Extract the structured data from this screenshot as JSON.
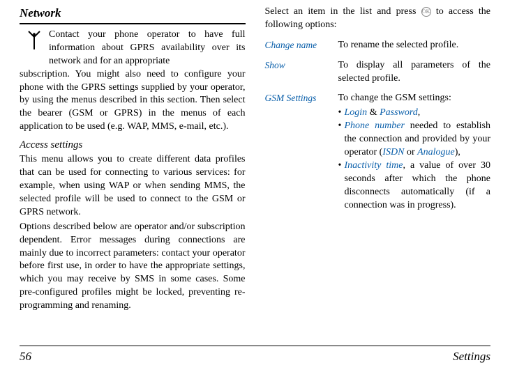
{
  "left": {
    "heading": "Network",
    "p1a": "Contact your phone operator to have full information about GPRS availability over its network and for an appropriate ",
    "p1b": "subscription. You might also need to configure your phone with the GPRS settings supplied by your operator, by using the menus described in this section. Then select the bearer (GSM or GPRS) in the menus of each application to be used (e.g. WAP, MMS, e-mail, etc.).",
    "subhead": "Access settings",
    "p2": "This menu allows you to create different data profiles that can be used for connecting to various services: for example, when using WAP or when sending MMS, the selected profile will be used to connect to the GSM or GPRS network.",
    "p3": "Options described below are operator and/or subscription dependent. Error messages during connections are mainly due to incorrect parameters: contact your operator before first use, in order to have the appropriate settings, which you may receive by SMS in some cases. Some pre-configured profiles might be locked, preventing re-programming and renaming."
  },
  "right": {
    "intro_a": "Select an item in the list and press ",
    "intro_b": " to access the following options:",
    "ok_glyph": "OK",
    "rows": {
      "change": {
        "term": "Change name",
        "def": "To rename the selected profile."
      },
      "show": {
        "term": "Show",
        "def": "To display all parameters of the selected profile."
      },
      "gsm": {
        "term": "GSM Settings",
        "def": "To change the GSM settings:"
      }
    },
    "bullets": {
      "b1": {
        "login": "Login",
        "amp": " & ",
        "pwd": "Password",
        "tail": ","
      },
      "b2": {
        "phone": "Phone number",
        "mid": " needed to establish the connection and provided by your operator (",
        "isdn": "ISDN",
        "or": " or ",
        "ana": "Analogue",
        "tail": "),"
      },
      "b3": {
        "inact": "Inactivity time",
        "tail": ", a value of over 30 seconds after which the phone disconnects automatically (if a connection was in progress)."
      }
    }
  },
  "footer": {
    "page": "56",
    "section": "Settings"
  }
}
